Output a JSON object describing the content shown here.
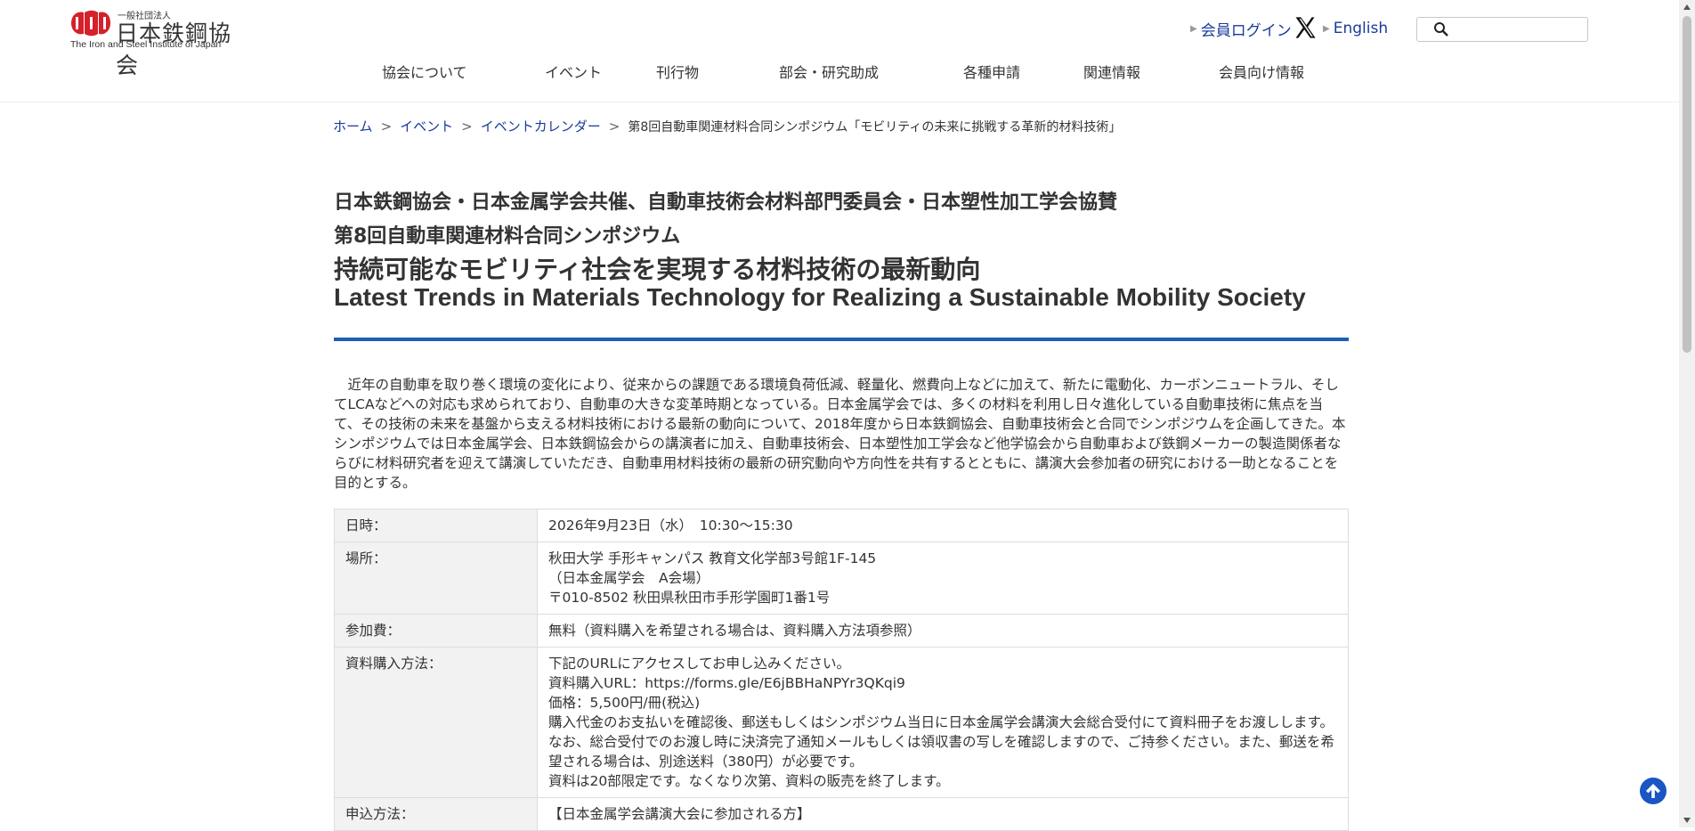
{
  "header": {
    "logo_small": "一般社団法人",
    "logo_jp": "日本鉄鋼協会",
    "logo_en": "The Iron and Steel Institute of Japan",
    "member_login": "会員ログイン",
    "english": "English",
    "x_icon": "x-logo-icon",
    "search_icon": "search-icon",
    "search_value": ""
  },
  "nav": {
    "about": "協会について",
    "events": "イベント",
    "publications": "刊行物",
    "divisions": "部会・研究助成",
    "applications": "各種申請",
    "related": "関連情報",
    "members": "会員向け情報"
  },
  "breadcrumb": {
    "home": "ホーム",
    "events": "イベント",
    "calendar": "イベントカレンダー",
    "current": "第8回自動車関連材料合同シンポジウム「モビリティの未来に挑戦する革新的材料技術」",
    "sep": ">"
  },
  "title": {
    "line1": "日本鉄鋼協会・日本金属学会共催、自動車技術会材料部門委員会・日本塑性加工学会協賛",
    "line2": "第8回自動車関連材料合同シンポジウム",
    "line3": "持続可能なモビリティ社会を実現する材料技術の最新動向",
    "line4": "Latest Trends in Materials Technology for Realizing a Sustainable Mobility Society"
  },
  "intro": "近年の自動車を取り巻く環境の変化により、従来からの課題である環境負荷低減、軽量化、燃費向上などに加えて、新たに電動化、カーボンニュートラル、そしてLCAなどへの対応も求められており、自動車の大きな変革時期となっている。日本金属学会では、多くの材料を利用し日々進化している自動車技術に焦点を当て、その技術の未来を基盤から支える材料技術における最新の動向について、2018年度から日本鉄鋼協会、自動車技術会と合同でシンポジウムを企画してきた。本シンポジウムでは日本金属学会、日本鉄鋼協会からの講演者に加え、自動車技術会、日本塑性加工学会など他学協会から自動車および鉄鋼メーカーの製造関係者ならびに材料研究者を迎えて講演していただき、自動車用材料技術の最新の研究動向や方向性を共有するとともに、講演大会参加者の研究における一助となることを目的とする。",
  "info": {
    "datetime": {
      "label": "日時：",
      "value": "2026年9月23日（水）　10:30～15:30"
    },
    "venue": {
      "label": "場所：",
      "line1": "秋田大学 手形キャンパス 教育文化学部3号館1F-145",
      "line2": "（日本金属学会　A会場）",
      "line3": "〒010-8502 秋田県秋田市手形学園町1番1号"
    },
    "fee": {
      "label": "参加費：",
      "value": "無料（資料購入を希望される場合は、資料購入方法項参照）"
    },
    "purchase": {
      "label": "資料購入方法：",
      "line1": "下記のURLにアクセスしてお申し込みください。",
      "line2": "資料購入URL：https://forms.gle/E6jBBHaNPYr3QKqi9",
      "line3": "価格：5,500円/冊(税込)",
      "line4": "購入代金のお支払いを確認後、郵送もしくはシンポジウム当日に日本金属学会講演大会総合受付にて資料冊子をお渡しします。なお、総合受付でのお渡し時に決済完了通知メールもしくは領収書の写しを確認しますので、ご持参ください。また、郵送を希望される場合は、別途送料（380円）が必要です。",
      "line5": "資料は20部限定です。なくなり次第、資料の販売を終了します。"
    },
    "apply": {
      "label": "申込方法：",
      "line1": "【日本金属学会講演大会に参加される方】"
    }
  },
  "colors": {
    "link": "#1a3a9a",
    "accent_rule": "#1a5fb4",
    "to_top": "#1a56c4",
    "logo_red": "#d6202a"
  }
}
